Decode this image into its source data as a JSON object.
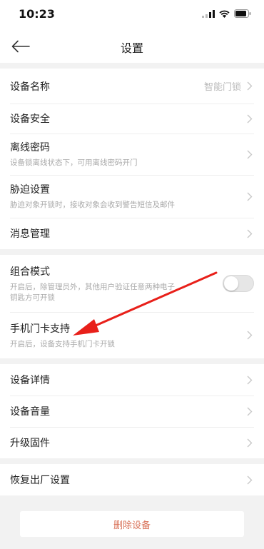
{
  "status_bar": {
    "time": "10:23"
  },
  "nav": {
    "title": "设置"
  },
  "groups": [
    [
      {
        "label": "设备名称",
        "value": "智能门锁"
      },
      {
        "label": "设备安全"
      },
      {
        "label": "离线密码",
        "sub": "设备锁离线状态下，可用离线密码开门"
      },
      {
        "label": "胁迫设置",
        "sub": "胁迫对象开锁时，接收对象会收到警告短信及邮件"
      },
      {
        "label": "消息管理"
      }
    ],
    [
      {
        "label": "组合模式",
        "sub": "开启后，除管理员外，其他用户验证任意两种电子钥匙方可开锁",
        "toggle": false
      },
      {
        "label": "手机门卡支持",
        "sub": "开启后，设备支持手机门卡开锁"
      }
    ],
    [
      {
        "label": "设备详情"
      },
      {
        "label": "设备音量"
      },
      {
        "label": "升级固件"
      }
    ],
    [
      {
        "label": "恢复出厂设置"
      }
    ]
  ],
  "delete_button": "删除设备",
  "colors": {
    "annotation_arrow": "#e8201a",
    "delete_text": "#d9735a"
  },
  "icons": {
    "back": "arrow-left-icon",
    "chevron": "chevron-right-icon"
  }
}
